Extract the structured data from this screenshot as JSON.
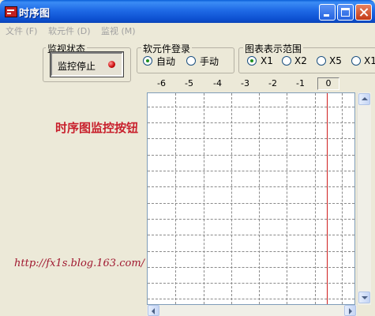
{
  "window": {
    "title": "时序图"
  },
  "menu": [
    {
      "label": "文件 (F)"
    },
    {
      "label": "软元件 (D)"
    },
    {
      "label": "监视 (M)"
    }
  ],
  "monitor_group": {
    "legend": "监视状态",
    "button_label": "监控停止",
    "led_color": "#d01010"
  },
  "device_group": {
    "legend": "软元件登录",
    "options": [
      {
        "label": "自动",
        "checked": true
      },
      {
        "label": "手动",
        "checked": false
      }
    ]
  },
  "range_group": {
    "legend": "图表表示范围",
    "options": [
      {
        "label": "X1",
        "checked": true
      },
      {
        "label": "X2",
        "checked": false
      },
      {
        "label": "X5",
        "checked": false
      },
      {
        "label": "X1",
        "checked": false
      }
    ]
  },
  "timeline": {
    "ticks": [
      "-6",
      "-5",
      "-4",
      "-3",
      "-2",
      "-1"
    ],
    "current": "0",
    "cursor_color": "#d02020"
  },
  "annotations": {
    "button_note": "时序图监控按钮",
    "url": "http://fx1s.blog.163.com/"
  }
}
